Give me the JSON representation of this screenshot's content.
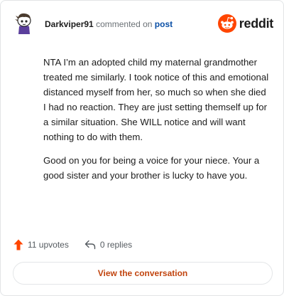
{
  "header": {
    "username": "Darkviper91",
    "commented_text": "commented on",
    "post_link": "post",
    "brand": "reddit",
    "colors": {
      "brand_orange": "#ff4500",
      "link_blue": "#0a4fa6"
    }
  },
  "comment": {
    "paragraphs": [
      "NTA I’m an adopted child my maternal grandmother treated me similarly. I took notice of this and emotional distanced myself from her, so much so when she died I had no reaction. They are just setting themself up for a similar situation. She WILL notice and will want nothing to do with them.",
      "Good on you for being a voice for your niece. Your a good sister and your brother is lucky to have you."
    ]
  },
  "footer": {
    "upvotes": "11 upvotes",
    "replies": "0 replies",
    "upvote_icon": "upvote-arrow-icon",
    "reply_icon": "reply-arrow-icon"
  },
  "cta": {
    "label": "View the conversation",
    "color": "#c1440e"
  }
}
